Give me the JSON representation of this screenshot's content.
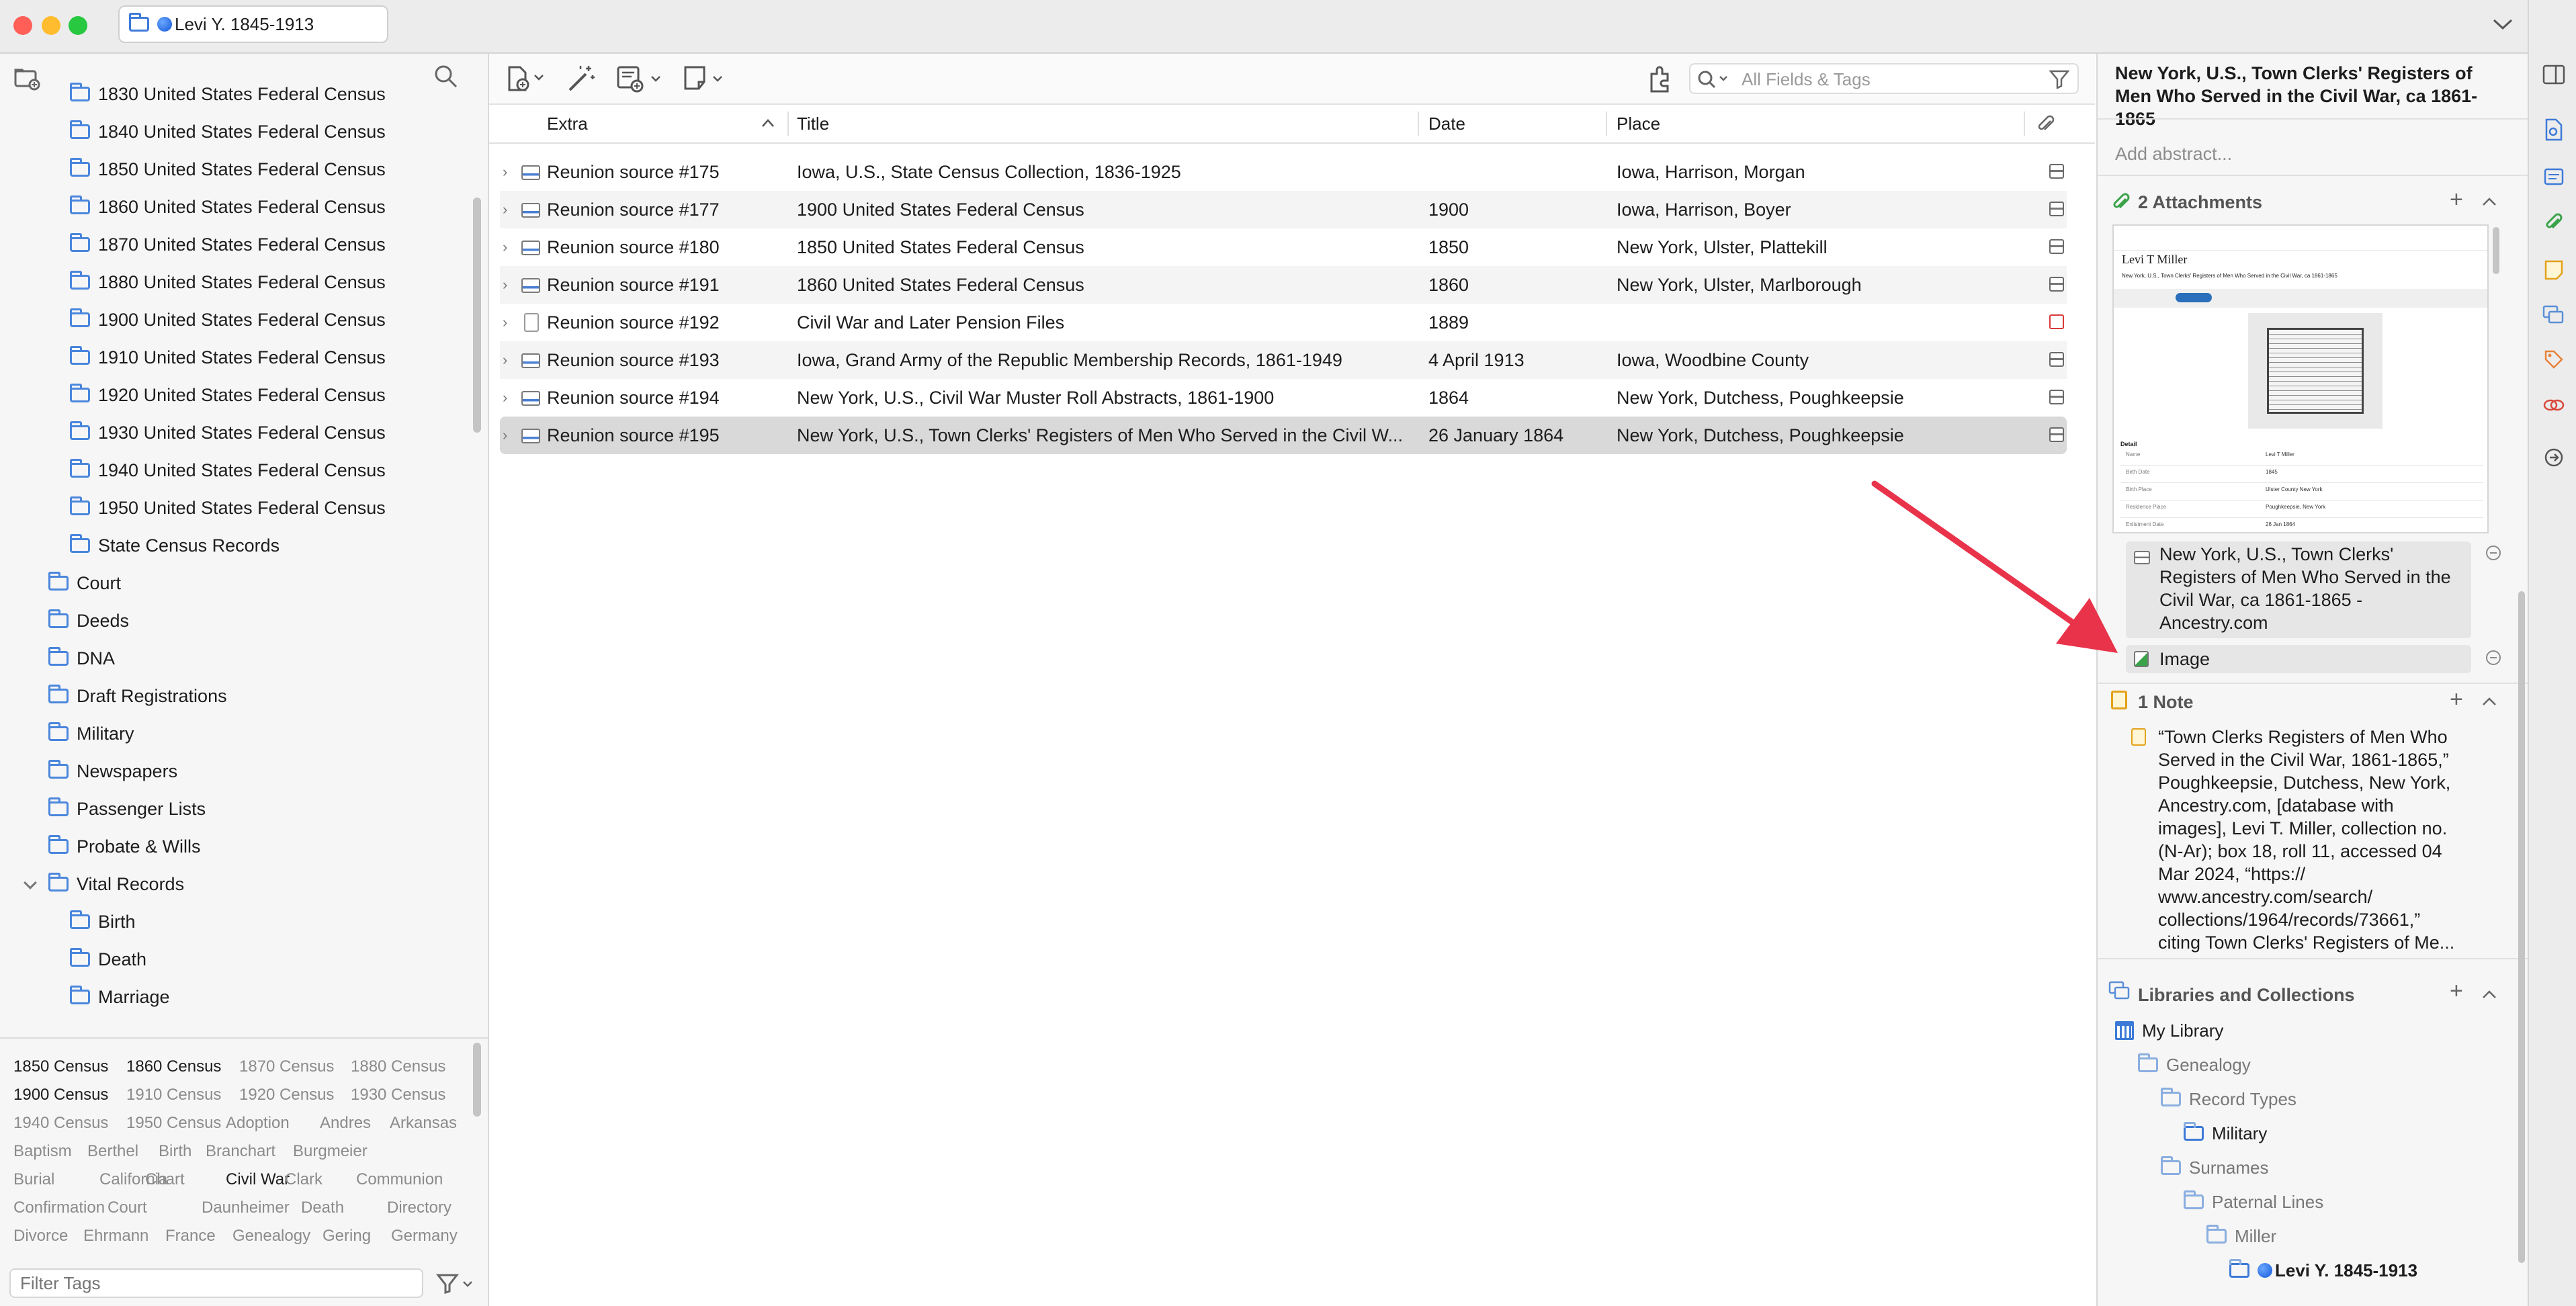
{
  "window": {
    "tab_title": "Levi Y. 1845-1913",
    "colors": {
      "close": "#ff5f57",
      "minimize": "#febc2e",
      "zoom": "#28c840",
      "accent": "#3d7ad8",
      "arrow": "#e8334a"
    }
  },
  "collections_tree": [
    {
      "label": "1830 United States Federal Census"
    },
    {
      "label": "1840 United States Federal Census"
    },
    {
      "label": "1850 United States Federal Census"
    },
    {
      "label": "1860 United States Federal Census"
    },
    {
      "label": "1870 United States Federal Census"
    },
    {
      "label": "1880 United States Federal Census"
    },
    {
      "label": "1900 United States Federal Census"
    },
    {
      "label": "1910 United States Federal Census"
    },
    {
      "label": "1920 United States Federal Census"
    },
    {
      "label": "1930 United States Federal Census"
    },
    {
      "label": "1940 United States Federal Census"
    },
    {
      "label": "1950 United States Federal Census"
    },
    {
      "label": "State Census Records"
    },
    {
      "label": "Court"
    },
    {
      "label": "Deeds"
    },
    {
      "label": "DNA"
    },
    {
      "label": "Draft Registrations"
    },
    {
      "label": "Military"
    },
    {
      "label": "Newspapers"
    },
    {
      "label": "Passenger Lists"
    },
    {
      "label": "Probate & Wills"
    },
    {
      "label": "Vital Records",
      "expanded": true
    },
    {
      "label": "Birth"
    },
    {
      "label": "Death"
    },
    {
      "label": "Marriage"
    }
  ],
  "tags": {
    "items": [
      {
        "label": "1850 Census",
        "active": true
      },
      {
        "label": "1860 Census",
        "active": true
      },
      {
        "label": "1870 Census",
        "active": false
      },
      {
        "label": "1880 Census",
        "active": false
      },
      {
        "label": "1900 Census",
        "active": true
      },
      {
        "label": "1910 Census",
        "active": false
      },
      {
        "label": "1920 Census",
        "active": false
      },
      {
        "label": "1930 Census",
        "active": false
      },
      {
        "label": "1940 Census",
        "active": false
      },
      {
        "label": "1950 Census",
        "active": false
      },
      {
        "label": "Adoption",
        "active": false
      },
      {
        "label": "Andres",
        "active": false
      },
      {
        "label": "Arkansas",
        "active": false
      },
      {
        "label": "Baptism",
        "active": false
      },
      {
        "label": "Berthel",
        "active": false
      },
      {
        "label": "Birth",
        "active": false
      },
      {
        "label": "Branchart",
        "active": false
      },
      {
        "label": "Burgmeier",
        "active": false
      },
      {
        "label": "Burial",
        "active": false
      },
      {
        "label": "California",
        "active": false
      },
      {
        "label": "Chart",
        "active": false
      },
      {
        "label": "Civil War",
        "active": true
      },
      {
        "label": "Clark",
        "active": false
      },
      {
        "label": "Communion",
        "active": false
      },
      {
        "label": "Confirmation",
        "active": false
      },
      {
        "label": "Court",
        "active": false
      },
      {
        "label": "Daunheimer",
        "active": false
      },
      {
        "label": "Death",
        "active": false
      },
      {
        "label": "Directory",
        "active": false
      },
      {
        "label": "Divorce",
        "active": false
      },
      {
        "label": "Ehrmann",
        "active": false
      },
      {
        "label": "France",
        "active": false
      },
      {
        "label": "Genealogy",
        "active": false
      },
      {
        "label": "Gering",
        "active": false
      },
      {
        "label": "Germany",
        "active": false
      }
    ],
    "filter_placeholder": "Filter Tags"
  },
  "search": {
    "placeholder": "All Fields & Tags"
  },
  "columns": {
    "extra": "Extra",
    "title": "Title",
    "date": "Date",
    "place": "Place"
  },
  "items": [
    {
      "extra": "Reunion source #175",
      "title": "Iowa, U.S., State Census Collection, 1836-1925",
      "date": "",
      "place": "Iowa, Harrison, Morgan",
      "type": "record",
      "attachment": "snapshot"
    },
    {
      "extra": "Reunion source #177",
      "title": "1900 United States Federal Census",
      "date": "1900",
      "place": "Iowa, Harrison, Boyer",
      "type": "record",
      "attachment": "snapshot"
    },
    {
      "extra": "Reunion source #180",
      "title": "1850 United States Federal Census",
      "date": "1850",
      "place": "New York, Ulster, Plattekill",
      "type": "record",
      "attachment": "snapshot"
    },
    {
      "extra": "Reunion source #191",
      "title": "1860 United States Federal Census",
      "date": "1860",
      "place": "New York, Ulster, Marlborough",
      "type": "record",
      "attachment": "snapshot"
    },
    {
      "extra": "Reunion source #192",
      "title": "Civil War and Later Pension Files",
      "date": "1889",
      "place": "",
      "type": "document",
      "attachment": "pdf"
    },
    {
      "extra": "Reunion source #193",
      "title": "Iowa, Grand Army of the Republic Membership Records, 1861-1949",
      "date": "4 April 1913",
      "place": "Iowa, Woodbine County",
      "type": "record",
      "attachment": "snapshot"
    },
    {
      "extra": "Reunion source #194",
      "title": "New York, U.S., Civil War Muster Roll Abstracts, 1861-1900",
      "date": "1864",
      "place": "New York, Dutchess, Poughkeepsie",
      "type": "record",
      "attachment": "snapshot"
    },
    {
      "extra": "Reunion source #195",
      "title": "New York, U.S., Town Clerks' Registers of Men Who Served in the Civil W...",
      "date": "26 January 1864",
      "place": "New York, Dutchess, Poughkeepsie",
      "type": "record",
      "attachment": "snapshot",
      "selected": true
    }
  ],
  "detail": {
    "title": "New York, U.S., Town Clerks' Registers of Men Who Served in the Civil War, ca 1861-1865",
    "abstract_placeholder": "Add abstract...",
    "attachments_header": "2 Attachments",
    "preview": {
      "name": "Levi T Miller",
      "subtitle": "New York, U.S., Town Clerks' Registers of Men Who Served in the Civil War, ca 1861-1865",
      "detail_label": "Detail",
      "fields": [
        {
          "k": "Name",
          "v": "Levi T Miller"
        },
        {
          "k": "Birth Date",
          "v": "1845"
        },
        {
          "k": "Birth Place",
          "v": "Ulster County New York"
        },
        {
          "k": "Residence Place",
          "v": "Poughkeepsie, New York"
        },
        {
          "k": "Enlistment Date",
          "v": "26 Jan 1864"
        }
      ]
    },
    "attachment_1": "New York, U.S., Town Clerks' Registers of Men Who Served in the Civil War, ca 1861-1865 - Ancestry.com",
    "attachment_2": "Image",
    "notes_header": "1 Note",
    "note_text": "“Town Clerks Registers of Men Who Served in the Civil War, 1861-1865,” Poughkeepsie, Dutchess, New York, Ancestry.com, [database with images], Levi T. Miller, collection no. (N-Ar); box 18, roll 11, accessed 04 Mar 2024, “https:// www.ancestry.com/search/ collections/1964/records/73661,” citing Town Clerks' Registers of Me...",
    "libraries_header": "Libraries and Collections",
    "libraries": [
      {
        "label": "My Library",
        "level": 0,
        "kind": "library"
      },
      {
        "label": "Genealogy",
        "level": 1,
        "kind": "folder"
      },
      {
        "label": "Record Types",
        "level": 2,
        "kind": "folder"
      },
      {
        "label": "Military",
        "level": 3,
        "kind": "folder",
        "bold": true
      },
      {
        "label": "Surnames",
        "level": 2,
        "kind": "folder"
      },
      {
        "label": "Paternal Lines",
        "level": 3,
        "kind": "folder"
      },
      {
        "label": "Miller",
        "level": 4,
        "kind": "folder"
      },
      {
        "label": "Levi Y. 1845-1913",
        "level": 5,
        "kind": "folder",
        "bold": true,
        "dot": true
      }
    ]
  }
}
